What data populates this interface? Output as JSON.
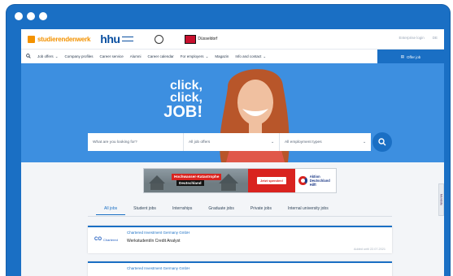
{
  "colors": {
    "accent": "#1a6fc4",
    "hero": "#3d8fe0",
    "brand_orange": "#f39200",
    "alert_red": "#d9231f"
  },
  "logos": {
    "studierendenwerk": "studierendenwerk",
    "hhu": "hhu",
    "hsd": "Düsseldorf"
  },
  "topbar": {
    "login": "Enterprise login",
    "lang": "DE"
  },
  "nav": {
    "items": [
      {
        "label": "Job offers",
        "icon": "chevron-down-icon"
      },
      {
        "label": "Company profiles"
      },
      {
        "label": "Career service"
      },
      {
        "label": "Alumni"
      },
      {
        "label": "Career calendar"
      },
      {
        "label": "For employers",
        "icon": "chevron-down-icon"
      },
      {
        "label": "Magazin"
      },
      {
        "label": "Info and contact",
        "icon": "chevron-down-icon"
      }
    ],
    "offer_job": "Offer job"
  },
  "hero": {
    "line1": "click,",
    "line2": "click,",
    "line3": "JOB!"
  },
  "search": {
    "what_placeholder": "What are you looking for?",
    "offers_value": "All job offers",
    "types_value": "All employment types"
  },
  "banner": {
    "headline": "Hochwasser-Katastrophe",
    "sub": "Deutschland",
    "donate": "Jetzt spenden!",
    "ad_line1": "Aktion",
    "ad_line2": "Deutschland Hilft"
  },
  "side_tab": "Merkliste",
  "tabs": [
    "All jobs",
    "Student jobs",
    "Internships",
    "Graduate jobs",
    "Private jobs",
    "Internal university jobs"
  ],
  "listings": [
    {
      "company": "Chartered Investment Germany GmbH",
      "title": "Werkstudent/in Credit Analyst",
      "logo_mark": "CO",
      "logo_name": "Chartered",
      "date": "Added until 22.07.2021"
    },
    {
      "company": "Chartered Investment Germany GmbH"
    }
  ]
}
